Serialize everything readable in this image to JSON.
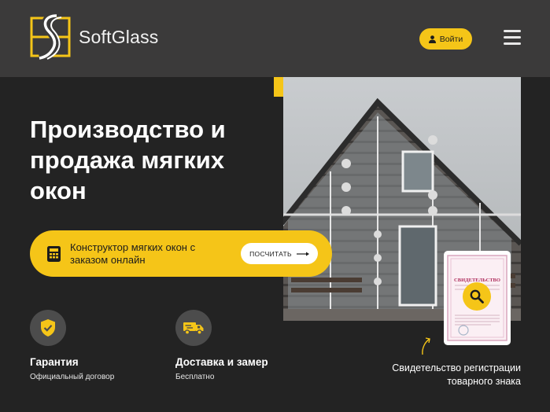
{
  "header": {
    "logo_text": "SoftGlass",
    "login_label": "Войти",
    "icons": {
      "logo": "softglass-logo-icon",
      "user": "user-icon",
      "menu": "hamburger-menu-icon"
    }
  },
  "hero": {
    "title": "Производство и продажа мягких окон",
    "photo": "house-with-soft-windows-photo"
  },
  "cta": {
    "text": "Конструктор мягких окон с заказом онлайн",
    "button_label": "ПОСЧИТАТЬ",
    "icons": {
      "calculator": "calculator-icon",
      "arrow": "arrow-right-icon"
    }
  },
  "features": [
    {
      "icon": "shield-check-icon",
      "title": "Гарантия",
      "subtitle": "Официальный договор"
    },
    {
      "icon": "truck-icon",
      "title": "Доставка и замер",
      "subtitle": "Бесплатно"
    }
  ],
  "certificate": {
    "doc_title": "СВИДЕТЕЛЬСТВО",
    "caption": "Свидетельство регистрации товарного знака",
    "icons": {
      "zoom": "magnifier-icon",
      "doodle": "curved-arrow-icon"
    }
  },
  "colors": {
    "accent": "#f5c518",
    "header_bg": "#3b3a3a",
    "page_bg": "#232323",
    "icon_circle": "#4c4c4c"
  }
}
